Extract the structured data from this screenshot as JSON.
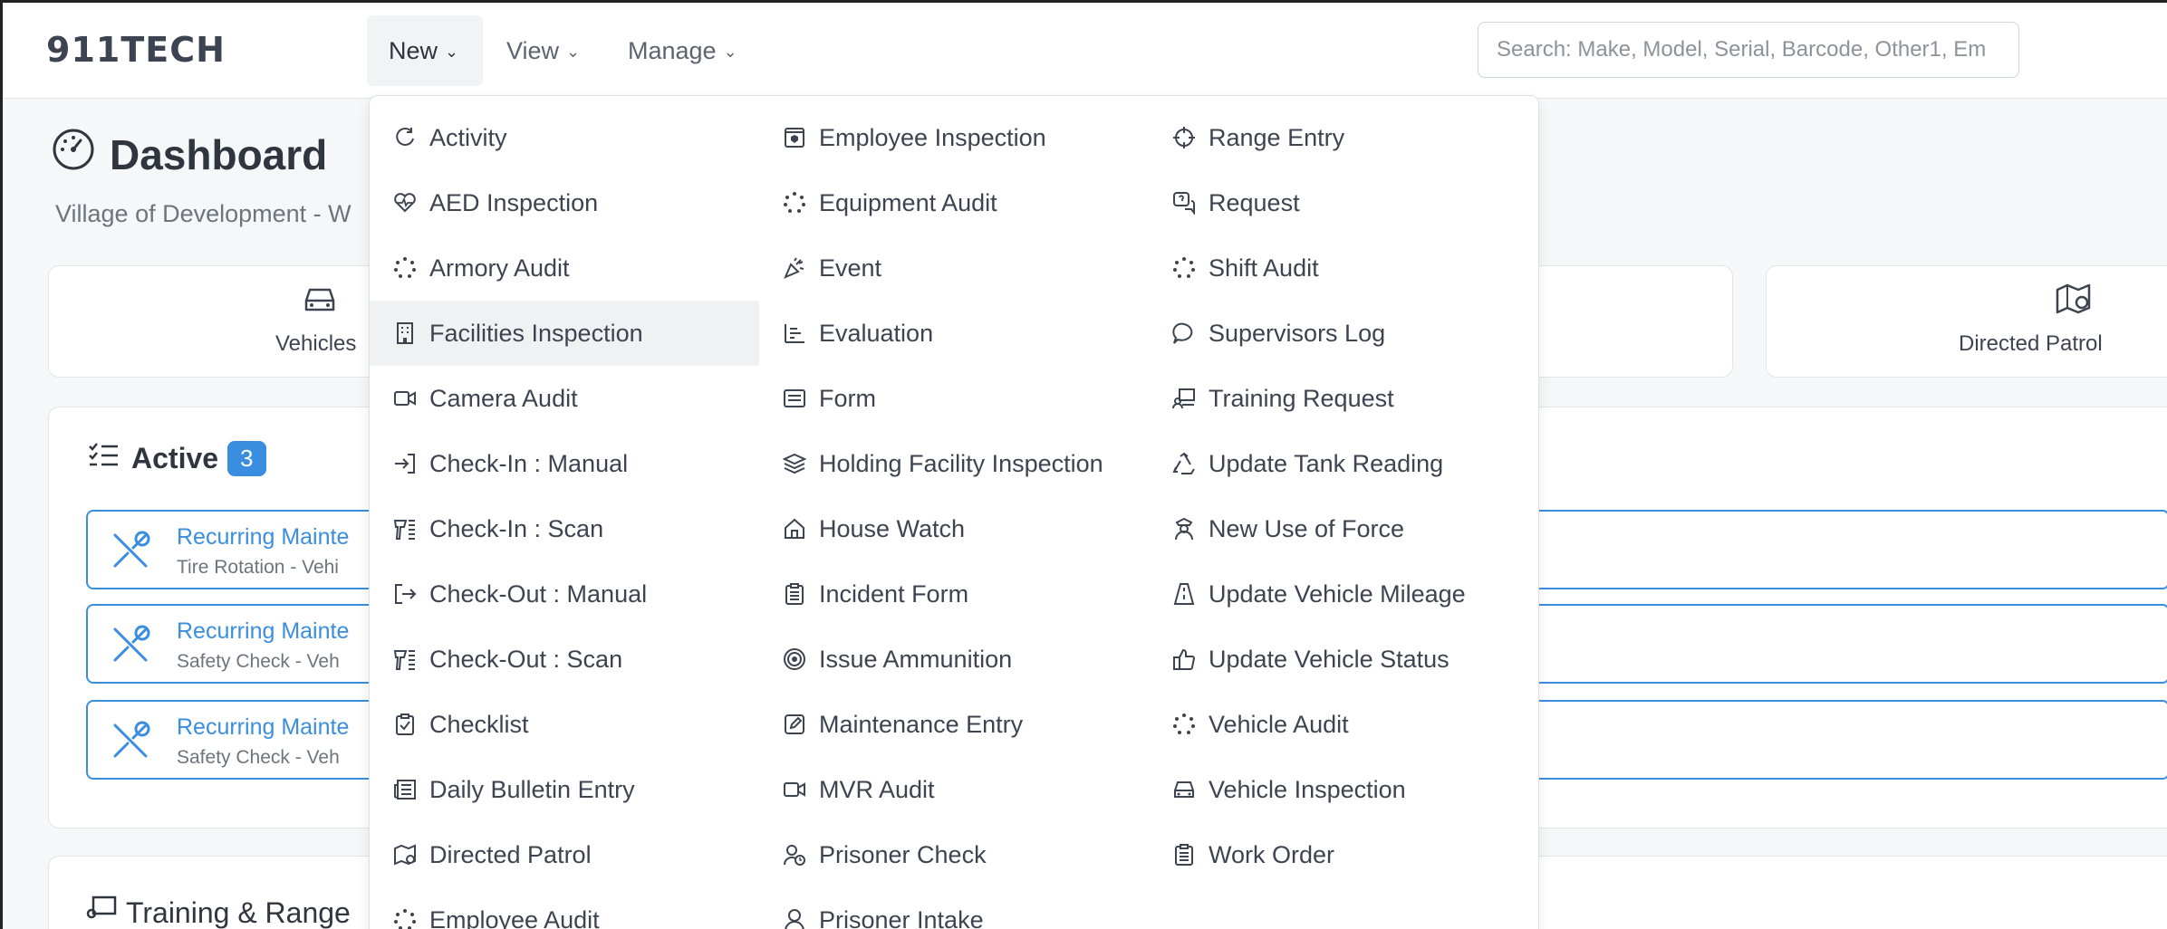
{
  "app": {
    "logo": "911TECH"
  },
  "nav": {
    "items": [
      {
        "label": "New",
        "open": true
      },
      {
        "label": "View",
        "open": false
      },
      {
        "label": "Manage",
        "open": false
      }
    ],
    "search_placeholder": "Search: Make, Model, Serial, Barcode, Other1, Em"
  },
  "dashboard": {
    "title": "Dashboard",
    "subtitle": "Village of Development - W",
    "quick_links": [
      {
        "label": "Vehicles",
        "icon": "car-icon"
      },
      {
        "label": "Directed Patrol",
        "icon": "map-pin-icon"
      }
    ],
    "active": {
      "label": "Active",
      "count": "3",
      "items": [
        {
          "title": "Recurring Mainte",
          "detail": "Tire Rotation - Vehi"
        },
        {
          "title": "Recurring Mainte",
          "detail": "Safety Check - Veh"
        },
        {
          "title": "Recurring Mainte",
          "detail": "Safety Check - Veh"
        }
      ]
    },
    "training_label": "Training & Range"
  },
  "menu": {
    "columns": [
      [
        {
          "label": "Activity",
          "icon": "refresh-icon"
        },
        {
          "label": "AED Inspection",
          "icon": "heart-pulse-icon"
        },
        {
          "label": "Armory Audit",
          "icon": "dotted-circle-icon"
        },
        {
          "label": "Facilities Inspection",
          "icon": "building-icon",
          "highlighted": true
        },
        {
          "label": "Camera Audit",
          "icon": "video-camera-icon"
        },
        {
          "label": "Check-In : Manual",
          "icon": "sign-in-icon"
        },
        {
          "label": "Check-In : Scan",
          "icon": "barcode-scanner-icon"
        },
        {
          "label": "Check-Out : Manual",
          "icon": "sign-out-icon"
        },
        {
          "label": "Check-Out : Scan",
          "icon": "barcode-scanner-icon"
        },
        {
          "label": "Checklist",
          "icon": "clipboard-check-icon"
        },
        {
          "label": "Daily Bulletin Entry",
          "icon": "newspaper-icon"
        },
        {
          "label": "Directed Patrol",
          "icon": "map-pin-icon"
        },
        {
          "label": "Employee Audit",
          "icon": "dotted-circle-icon"
        }
      ],
      [
        {
          "label": "Employee Inspection",
          "icon": "badge-icon"
        },
        {
          "label": "Equipment Audit",
          "icon": "dotted-circle-icon"
        },
        {
          "label": "Event",
          "icon": "party-icon"
        },
        {
          "label": "Evaluation",
          "icon": "chart-bars-icon"
        },
        {
          "label": "Form",
          "icon": "form-icon"
        },
        {
          "label": "Holding Facility Inspection",
          "icon": "stack-icon"
        },
        {
          "label": "House Watch",
          "icon": "house-icon"
        },
        {
          "label": "Incident Form",
          "icon": "clipboard-list-icon"
        },
        {
          "label": "Issue Ammunition",
          "icon": "target-icon"
        },
        {
          "label": "Maintenance Entry",
          "icon": "pencil-square-icon"
        },
        {
          "label": "MVR Audit",
          "icon": "video-camera-icon"
        },
        {
          "label": "Prisoner Check",
          "icon": "user-clock-icon"
        },
        {
          "label": "Prisoner Intake",
          "icon": "user-icon"
        }
      ],
      [
        {
          "label": "Range Entry",
          "icon": "crosshair-icon"
        },
        {
          "label": "Request",
          "icon": "question-chat-icon"
        },
        {
          "label": "Shift Audit",
          "icon": "dotted-circle-icon"
        },
        {
          "label": "Supervisors Log",
          "icon": "chat-bubble-icon"
        },
        {
          "label": "Training Request",
          "icon": "presenter-icon"
        },
        {
          "label": "Update Tank Reading",
          "icon": "recycle-icon"
        },
        {
          "label": "New Use of Force",
          "icon": "officer-icon"
        },
        {
          "label": "Update Vehicle Mileage",
          "icon": "road-icon"
        },
        {
          "label": "Update Vehicle Status",
          "icon": "thumbs-up-icon"
        },
        {
          "label": "Vehicle Audit",
          "icon": "dotted-circle-icon"
        },
        {
          "label": "Vehicle Inspection",
          "icon": "car-icon"
        },
        {
          "label": "Work Order",
          "icon": "clipboard-list-icon"
        }
      ]
    ]
  },
  "colors": {
    "accent": "#3a8ee0",
    "text": "#3d4451",
    "muted": "#6c757d",
    "hover": "#f0f1f3"
  }
}
